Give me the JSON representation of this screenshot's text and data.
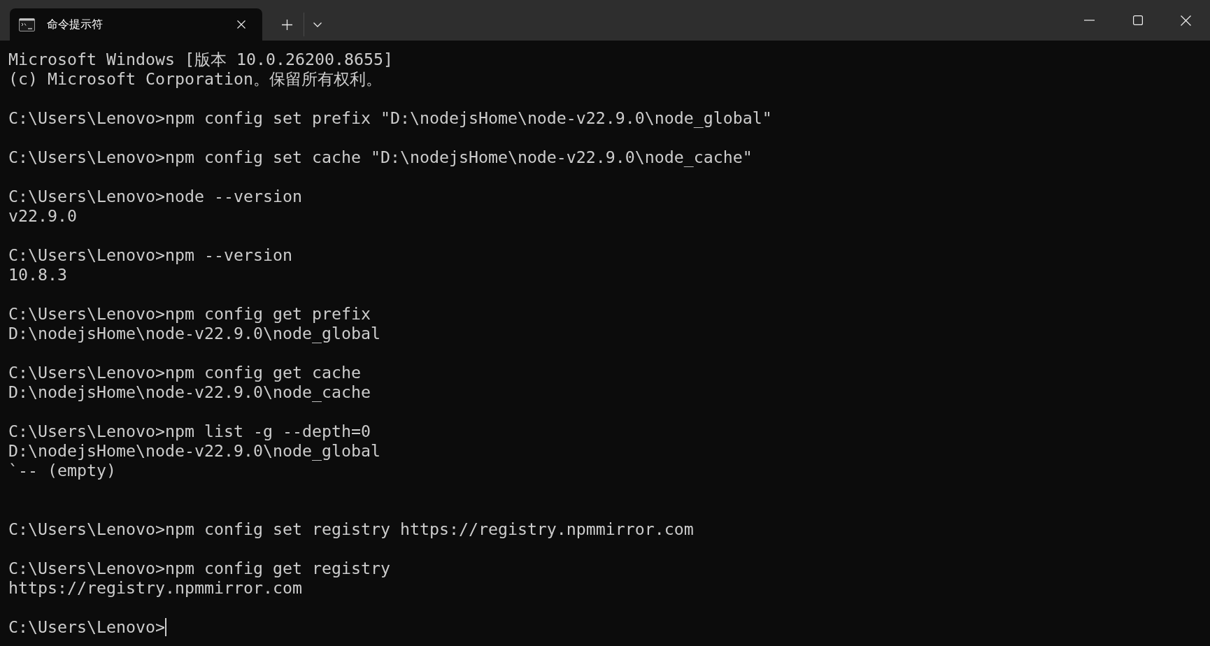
{
  "tab_bar": {
    "tabs": [
      {
        "title": "命令提示符",
        "selected": true
      }
    ]
  },
  "console": {
    "lines": [
      {
        "kind": "text",
        "text": "Microsoft Windows [版本 10.0.26200.8655]"
      },
      {
        "kind": "text",
        "text": "(c) Microsoft Corporation。保留所有权利。"
      },
      {
        "kind": "blank"
      },
      {
        "kind": "text",
        "text": "C:\\Users\\Lenovo>npm config set prefix \"D:\\nodejsHome\\node-v22.9.0\\node_global\""
      },
      {
        "kind": "blank"
      },
      {
        "kind": "text",
        "text": "C:\\Users\\Lenovo>npm config set cache \"D:\\nodejsHome\\node-v22.9.0\\node_cache\""
      },
      {
        "kind": "blank"
      },
      {
        "kind": "text",
        "text": "C:\\Users\\Lenovo>node --version"
      },
      {
        "kind": "text",
        "text": "v22.9.0"
      },
      {
        "kind": "blank"
      },
      {
        "kind": "text",
        "text": "C:\\Users\\Lenovo>npm --version"
      },
      {
        "kind": "text",
        "text": "10.8.3"
      },
      {
        "kind": "blank"
      },
      {
        "kind": "text",
        "text": "C:\\Users\\Lenovo>npm config get prefix"
      },
      {
        "kind": "text",
        "text": "D:\\nodejsHome\\node-v22.9.0\\node_global"
      },
      {
        "kind": "blank"
      },
      {
        "kind": "text",
        "text": "C:\\Users\\Lenovo>npm config get cache"
      },
      {
        "kind": "text",
        "text": "D:\\nodejsHome\\node-v22.9.0\\node_cache"
      },
      {
        "kind": "blank"
      },
      {
        "kind": "text",
        "text": "C:\\Users\\Lenovo>npm list -g --depth=0"
      },
      {
        "kind": "text",
        "text": "D:\\nodejsHome\\node-v22.9.0\\node_global"
      },
      {
        "kind": "text",
        "text": "`-- (empty)"
      },
      {
        "kind": "blank"
      },
      {
        "kind": "blank"
      },
      {
        "kind": "text",
        "text": "C:\\Users\\Lenovo>npm config set registry https://registry.npmmirror.com"
      },
      {
        "kind": "blank"
      },
      {
        "kind": "text",
        "text": "C:\\Users\\Lenovo>npm config get registry"
      },
      {
        "kind": "text",
        "text": "https://registry.npmmirror.com"
      },
      {
        "kind": "blank"
      }
    ],
    "input_line": {
      "prompt": "C:\\Users\\Lenovo>",
      "cursor": true
    }
  }
}
